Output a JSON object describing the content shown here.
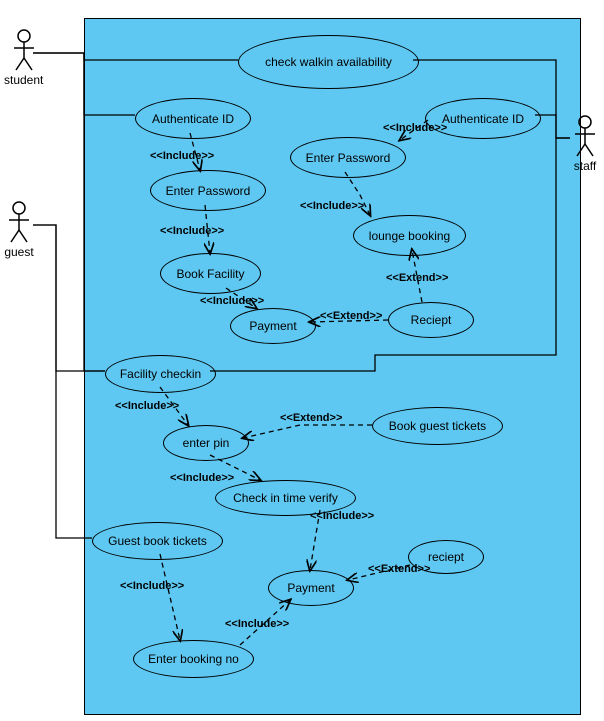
{
  "actors": {
    "student": "student",
    "guest": "guest",
    "staff": "staff"
  },
  "usecases": {
    "check_walkin": "check walkin availability",
    "auth_id_left": "Authenticate ID",
    "auth_id_right": "Authenticate ID",
    "enter_pw_left": "Enter Password",
    "enter_pw_right": "Enter Password",
    "book_facility": "Book Facility",
    "lounge_booking": "lounge booking",
    "payment1": "Payment",
    "receipt1": "Reciept",
    "facility_checkin": "Facility checkin",
    "enter_pin": "enter pin",
    "book_guest_tickets": "Book guest tickets",
    "checkin_verify": "Check in time verify",
    "guest_book_tickets": "Guest book tickets",
    "payment2": "Payment",
    "receipt2": "reciept",
    "enter_booking_no": "Enter booking no"
  },
  "stereotypes": {
    "include": "<<Include>>",
    "extend": "<<Extend>>"
  }
}
